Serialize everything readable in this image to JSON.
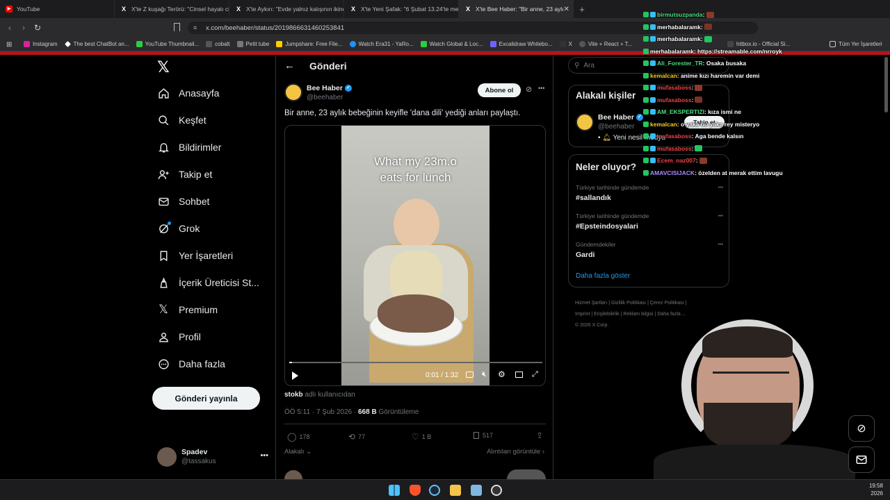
{
  "browser": {
    "tabs": [
      {
        "label": "YouTube",
        "icon": "youtube-icon",
        "color": "#ff0000"
      },
      {
        "label": "X'te Z kuşağı Terörü: \"Cinsel hayatı ci",
        "icon": "x-icon"
      },
      {
        "label": "X'te Aykırı: \"Evde yalnız kalışının ikinc",
        "icon": "x-icon"
      },
      {
        "label": "X'te Yeni Şafak: \"6 Şubat 13.24'te me",
        "icon": "x-icon"
      },
      {
        "label": "X'te Bee Haber: \"Bir anne, 23 aylı",
        "icon": "x-icon"
      }
    ],
    "url": "x.com/beehaber/status/2019866631460253841",
    "bookmarks": [
      {
        "label": "Instagram",
        "color": "#d6249f"
      },
      {
        "label": "The best ChatBot an...",
        "color": "#ffffff"
      },
      {
        "label": "YouTube Thumbnail...",
        "color": "#2ecc40"
      },
      {
        "label": "cobalt",
        "color": "#ffffff"
      },
      {
        "label": "Petit tube",
        "color": "#ffffff"
      },
      {
        "label": "Jumpshare: Free File...",
        "color": "#ffcc00"
      },
      {
        "label": "Watch Era31 - YaRo...",
        "color": "#1e90ff"
      },
      {
        "label": "Watch Global & Loc...",
        "color": "#2ecc40"
      },
      {
        "label": "Excalidraw Whitebo...",
        "color": "#6c63ff"
      },
      {
        "label": "X",
        "color": "#ffffff"
      },
      {
        "label": "Vite + React + T...",
        "color": "#ffffff"
      }
    ],
    "bookmarks_right": [
      "hitbox.io - Official Si...",
      "Tüm Yer İşaretleri"
    ]
  },
  "nav": {
    "items": [
      {
        "label": "Anasayfa",
        "icon": "home-icon"
      },
      {
        "label": "Keşfet",
        "icon": "search-icon"
      },
      {
        "label": "Bildirimler",
        "icon": "bell-icon"
      },
      {
        "label": "Takip et",
        "icon": "follow-icon"
      },
      {
        "label": "Sohbet",
        "icon": "mail-icon"
      },
      {
        "label": "Grok",
        "icon": "grok-icon"
      },
      {
        "label": "Yer İşaretleri",
        "icon": "bookmark-icon"
      },
      {
        "label": "İçerik Üreticisi St...",
        "icon": "creator-icon"
      },
      {
        "label": "Premium",
        "icon": "x-logo-icon"
      },
      {
        "label": "Profil",
        "icon": "profile-icon"
      },
      {
        "label": "Daha fazla",
        "icon": "more-circle-icon"
      }
    ],
    "post_button": "Gönderi yayınla",
    "account": {
      "name": "Spadev",
      "handle": "@tassakus"
    }
  },
  "main": {
    "header_title": "Gönderi",
    "author_name": "Bee Haber",
    "author_handle": "@beehaber",
    "subscribe_label": "Abone ol",
    "tweet_text": "Bir anne, 23 aylık bebeğinin keyifle 'dana dili' yediği anları paylaştı.",
    "video_caption_line1": "What my 23m.o",
    "video_caption_line2": "eats for lunch",
    "video_time": "0:01 / 1:32",
    "video_progress": 0.01,
    "attribution_user": "stokb",
    "attribution_suffix": " adlı kullanıcıdan",
    "meta_time": "ÖÖ 5:11 · 7 Şub 2026 · ",
    "meta_views": "668 B",
    "meta_views_label": " Görüntüleme",
    "stats": {
      "replies": "178",
      "reposts": "77",
      "likes": "1 B",
      "bookmarks": "517"
    },
    "relevant_label": "Alakalı",
    "quotes_label": "Alıntıları görüntüle"
  },
  "right": {
    "search_placeholder": "Ara",
    "relevant_people_title": "Alakalı kişiler",
    "person_name": "Bee Haber",
    "person_handle": "@beehaber",
    "person_bio": "Yeni nesil medya",
    "follow_label": "Takip et",
    "trends_title": "Neler oluyor?",
    "trends": [
      {
        "category": "Türkiye tarihinde gündemde",
        "title": "#sallandık"
      },
      {
        "category": "Türkiye tarihinde gündemde",
        "title": "#Epsteindosyalari"
      },
      {
        "category": "Gündemdekiler",
        "title": "Gardi"
      }
    ],
    "show_more": "Daha fazla göster",
    "footer_links": [
      "Hizmet Şartları",
      "Gizlilik Politikası",
      "Çerez Politikası",
      "Imprint",
      "Erişilebilirlik",
      "Reklam bilgisi",
      "Daha fazla ..."
    ],
    "copyright": "© 2026 X Corp."
  },
  "chat": [
    {
      "user": "birmutsuzpanda",
      "color": "#4ade80",
      "msg": " :",
      "emote": true
    },
    {
      "user": "merhabalaramk",
      "color": "#ffffff",
      "msg": " :",
      "emote": true
    },
    {
      "user": "merhabalaramk",
      "color": "#ffffff",
      "msg": " :",
      "emote": true
    },
    {
      "user": "merhabalaramk",
      "color": "#ffffff",
      "msg": " : https://streamable.com/nrroyk",
      "emote": false
    },
    {
      "user": "Ali_Forester_TR",
      "color": "#4ade80",
      "msg": " : Osaka busaka",
      "emote": false
    },
    {
      "user": "kemalcan",
      "color": "#facc15",
      "msg": " : anime kızı haremin var demi",
      "emote": false
    },
    {
      "user": "mufasaboss",
      "color": "#ef4444",
      "msg": " :",
      "emote": true
    },
    {
      "user": "mufasaboss",
      "color": "#ef4444",
      "msg": " :",
      "emote": true
    },
    {
      "user": "AM_EKSPERTIZI",
      "color": "#4ade80",
      "msg": " : kıza ismi ne",
      "emote": false
    },
    {
      "user": "kemalcan",
      "color": "#facc15",
      "msg": " : o yaka bu yaka rey misteryo",
      "emote": false
    },
    {
      "user": "mufasaboss",
      "color": "#ef4444",
      "msg": " : Aga bende kalsın",
      "emote": false
    },
    {
      "user": "mufasaboss",
      "color": "#ef4444",
      "msg": " :",
      "emote": true
    },
    {
      "user": "Ecem_naz007",
      "color": "#ef4444",
      "msg": " :",
      "emote": true
    },
    {
      "user": "AMAVCISIJACK",
      "color": "#a78bfa",
      "msg": " : özelden at merak ettim lavugu",
      "emote": false
    }
  ],
  "taskbar": {
    "time": "19:58",
    "date": "2026"
  }
}
